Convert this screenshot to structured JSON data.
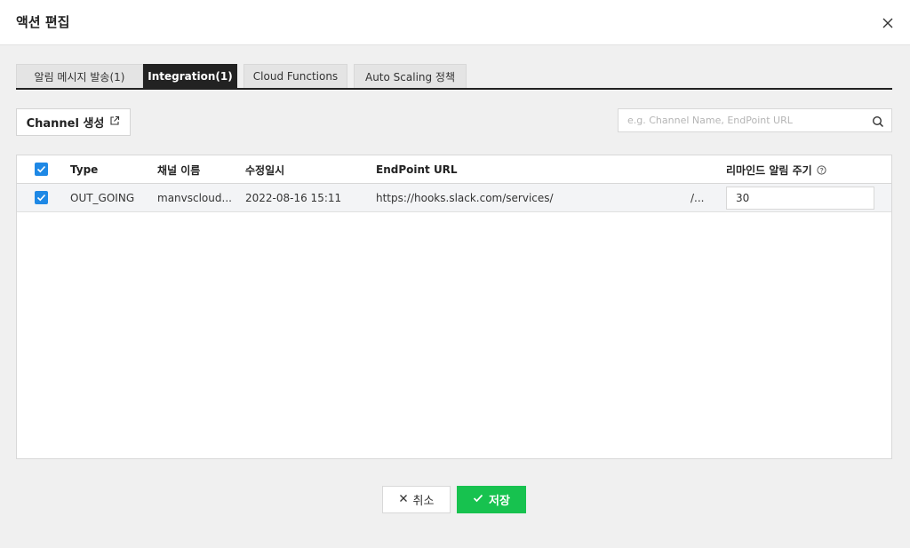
{
  "modal": {
    "title": "액션 편집"
  },
  "tabs": [
    {
      "label": "알림 메시지 발송(1)",
      "active": false
    },
    {
      "label": "Integration(1)",
      "active": true
    },
    {
      "label": "Cloud Functions",
      "active": false
    },
    {
      "label": "Auto Scaling 정책",
      "active": false
    }
  ],
  "toolbar": {
    "channel_button": "Channel 생성",
    "search_placeholder": "e.g. Channel Name, EndPoint URL"
  },
  "table": {
    "columns": {
      "type": "Type",
      "channel_name": "채널 이름",
      "modified": "수정일시",
      "endpoint": "EndPoint URL",
      "remind": "리마인드 알림 주기"
    },
    "rows": [
      {
        "checked": true,
        "type": "OUT_GOING",
        "channel_name": "manvscloud...",
        "modified": "2022-08-16 15:11",
        "endpoint": "https://hooks.slack.com/services/",
        "endpoint_tail": "/...",
        "remind": "30"
      }
    ]
  },
  "footer": {
    "cancel_label": "취소",
    "save_label": "저장"
  },
  "colors": {
    "accent_blue": "#1e88e5",
    "save_green": "#17c24f",
    "active_tab": "#222222"
  }
}
